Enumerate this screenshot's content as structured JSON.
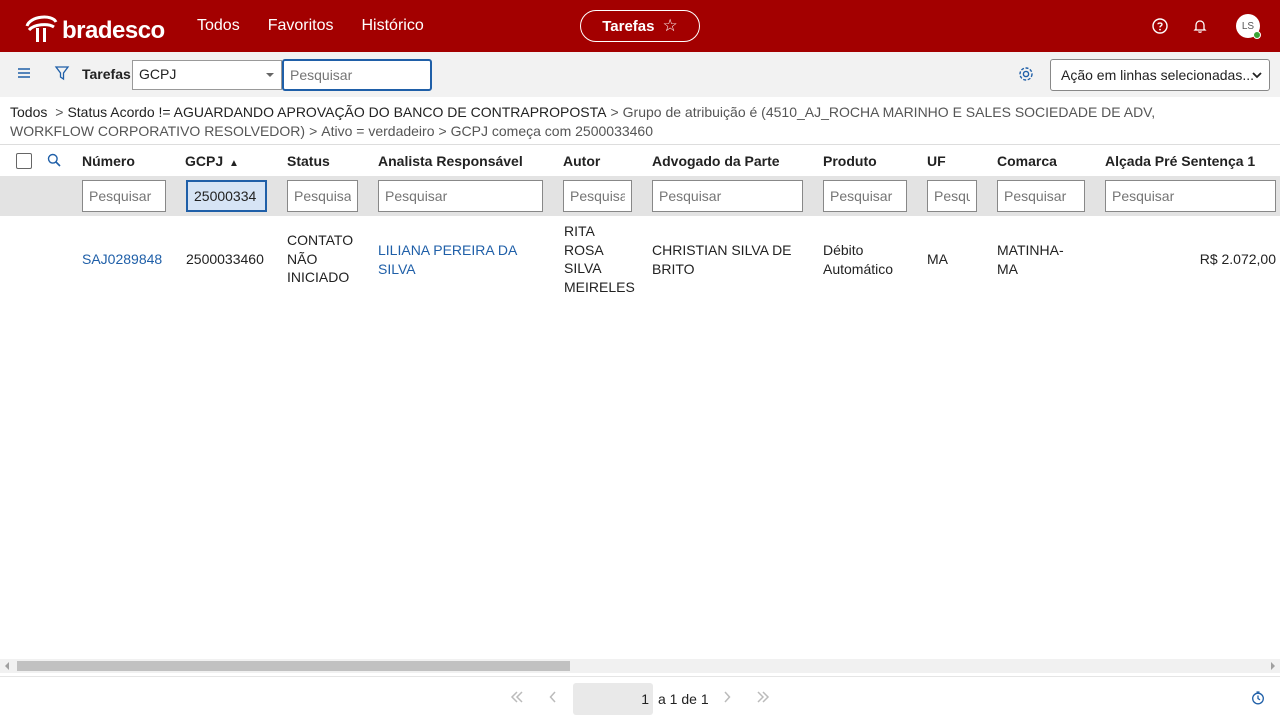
{
  "header": {
    "brand": "bradesco",
    "nav": [
      "Todos",
      "Favoritos",
      "Histórico"
    ],
    "tasks_pill": "Tarefas",
    "avatar_initials": "LS",
    "brand_color": "#a30000"
  },
  "toolbar": {
    "label": "Tarefas",
    "field_select": "GCPJ",
    "search_placeholder": "Pesquisar",
    "action_select": "Ação em linhas selecionadas..."
  },
  "breadcrumb": {
    "root": "Todos",
    "conditions": [
      "Status Acordo != AGUARDANDO APROVAÇÃO DO BANCO DE CONTRAPROPOSTA",
      "Grupo de atribuição é (4510_AJ_ROCHA MARINHO E SALES SOCIEDADE DE ADV, WORKFLOW CORPORATIVO RESOLVEDOR)",
      "Ativo = verdadeiro",
      "GCPJ começa com 2500033460"
    ]
  },
  "table": {
    "columns": [
      "Número",
      "GCPJ",
      "Status",
      "Analista Responsável",
      "Autor",
      "Advogado da Parte",
      "Produto",
      "UF",
      "Comarca",
      "Alçada Pré Sentença 1"
    ],
    "filter_placeholder": "Pesquisar",
    "gcpj_filter_value": "25000334",
    "sorted_column": "GCPJ",
    "rows": [
      {
        "numero": "SAJ0289848",
        "gcpj": "2500033460",
        "status": "CONTATO NÃO INICIADO",
        "analista": "LILIANA PEREIRA DA SILVA",
        "autor": "RITA ROSA SILVA MEIRELES",
        "advogado": "CHRISTIAN SILVA DE BRITO",
        "produto": "Débito Automático",
        "uf": "MA",
        "comarca": "MATINHA-MA",
        "alcada": "R$ 2.072,00"
      }
    ]
  },
  "pagination": {
    "current_page": "1",
    "of_text": "a 1 de 1"
  }
}
